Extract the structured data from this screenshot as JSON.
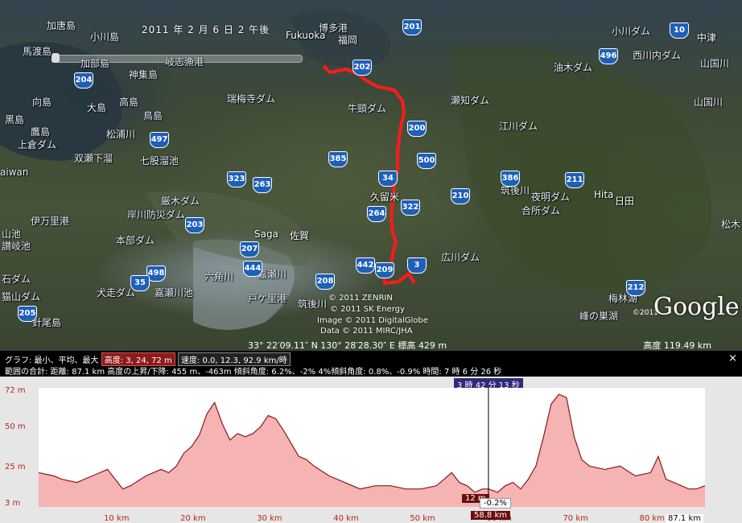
{
  "map": {
    "datetime": "2011 年 2 月 6 日  2 午後",
    "cities": [
      {
        "label": "Fukuoka",
        "class": "w"
      },
      {
        "label": "福岡",
        "class": "w"
      },
      {
        "label": "久留米",
        "class": "w"
      },
      {
        "label": "Saga",
        "class": "w"
      },
      {
        "label": "佐賀",
        "class": "w"
      },
      {
        "label": "Hita",
        "class": "w"
      },
      {
        "label": "日田",
        "class": "w"
      },
      {
        "label": "中津",
        "class": "w"
      }
    ],
    "labels": [
      "加唐島",
      "小川島",
      "馬渡島",
      "加部島",
      "神集島",
      "岐志漁港",
      "向島",
      "大島",
      "高島",
      "黒島",
      "鷹島",
      "上倉ダム",
      "双瀬下溜",
      "七股溜池",
      "松浦川",
      "鳥島",
      "aiwan",
      "厳木ダム",
      "岸川防災ダム",
      "伊万里港",
      "山池",
      "讃岐池",
      "本部ダム",
      "石ダム",
      "猫山ダム",
      "犬走ダム",
      "嘉瀬川池",
      "六角川",
      "針尾島",
      "嘉瀬川",
      "戸ケ里港",
      "筑後川",
      "博多港",
      "牛頸ダム",
      "瀬知ダム",
      "江川ダム",
      "油木ダム",
      "小川ダム",
      "西川内ダム",
      "山国川",
      "筑後川",
      "夜明ダム",
      "合所ダム",
      "広川ダム",
      "松木",
      "梅林湖",
      "峰の巣湖",
      "瑞梅寺ダム",
      "山国川"
    ],
    "shields": [
      "201",
      "202",
      "204",
      "200",
      "497",
      "385",
      "500",
      "386",
      "211",
      "323",
      "263",
      "34",
      "264",
      "322",
      "210",
      "203",
      "207",
      "444",
      "498",
      "35",
      "442",
      "209",
      "3",
      "208",
      "205",
      "212",
      "496",
      "10"
    ],
    "attribution": {
      "zenrin": "© 2011 ZENRIN",
      "skenergy": "© 2011 SK Energy",
      "digitalglobe": "Image © 2011 DigitalGlobe",
      "mirc": "Data © 2011 MIRC/JHA",
      "year": "©2011"
    },
    "coords": "33° 22′09.11″ N   130° 28′28.30″ E  標高  429 m",
    "altitude": "高度   119.49 km",
    "logo": "Google"
  },
  "profile": {
    "graph_label": "グラフ: 最小、平均、最大",
    "elevation_chip": "高度: 3, 24, 72 m",
    "speed_chip": "速度: 0.0, 12.3, 92.9 km/時",
    "summary_label": "範囲の合計:",
    "summary": "距離: 87.1 km  高度の上昇/下降: 455 m、-463m 傾斜角度: 6.2%、-2%  4%傾斜角度: 0.8%、-0.9%  時間: 7 時 6 分 26 秒",
    "close": "×",
    "cursor_time": "3 時 42 分 13 秒",
    "cursor_elev": "12 m",
    "cursor_grade": "-0.2%",
    "cursor_dist": "58.8 km",
    "total_dist": "87.1 km"
  },
  "chart_data": {
    "type": "area",
    "title": "",
    "xlabel": "",
    "ylabel": "",
    "y_ticks": [
      "72 m",
      "50 m",
      "25 m",
      "3 m"
    ],
    "y_tick_values": [
      72,
      50,
      25,
      3
    ],
    "x_ticks": [
      "10 km",
      "20 km",
      "30 km",
      "40 km",
      "50 km",
      "60 km",
      "70 km",
      "80 km"
    ],
    "x_tick_values": [
      10,
      20,
      30,
      40,
      50,
      60,
      70,
      80
    ],
    "xlim": [
      0,
      87.1
    ],
    "ylim": [
      3,
      72
    ],
    "series": [
      {
        "x": [
          0,
          2,
          3,
          5,
          7,
          9,
          10,
          11,
          12,
          14,
          15,
          16,
          17,
          18,
          19,
          20,
          21,
          22,
          23,
          24,
          25,
          26,
          27,
          28,
          29,
          30,
          31,
          32,
          33,
          34,
          35,
          36,
          38,
          40,
          42,
          44,
          46,
          48,
          50,
          52,
          53,
          54,
          55,
          56,
          57,
          58,
          58.8,
          60,
          61,
          62,
          63,
          64,
          65,
          66,
          67,
          68,
          69,
          70,
          71,
          72,
          74,
          76,
          78,
          80,
          81,
          82,
          83,
          84,
          85,
          86,
          87.1
        ],
        "y": [
          22,
          20,
          18,
          16,
          20,
          24,
          18,
          12,
          14,
          20,
          22,
          24,
          22,
          26,
          34,
          38,
          45,
          58,
          65,
          52,
          42,
          46,
          44,
          46,
          50,
          57,
          55,
          48,
          40,
          32,
          30,
          26,
          20,
          16,
          12,
          14,
          14,
          12,
          12,
          14,
          18,
          22,
          16,
          14,
          10,
          12,
          12,
          10,
          14,
          16,
          12,
          18,
          26,
          44,
          64,
          70,
          68,
          44,
          30,
          26,
          24,
          26,
          20,
          22,
          32,
          18,
          16,
          14,
          12,
          12,
          14
        ]
      }
    ],
    "grid": false,
    "legend": "none",
    "fill_color": "#f5b3b3",
    "line_color": "#8a1a1a"
  }
}
